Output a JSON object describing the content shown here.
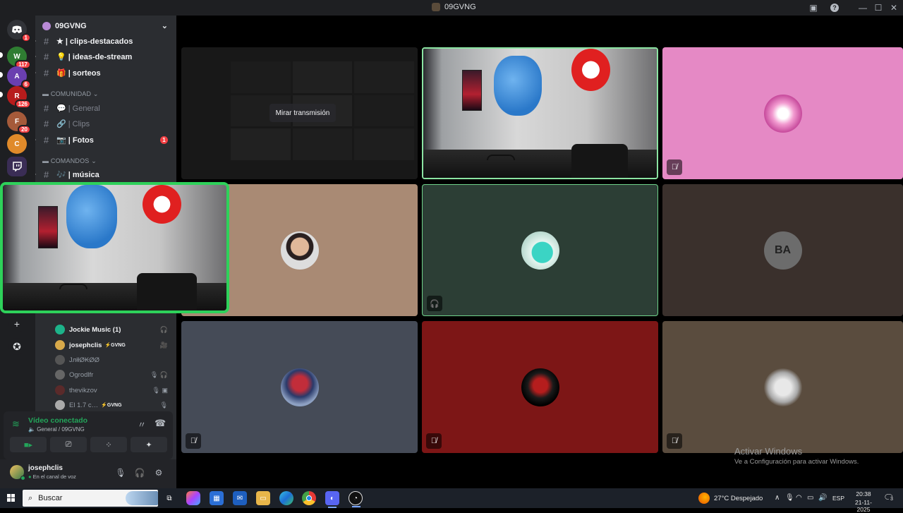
{
  "titlebar": {
    "title": "09GVNG"
  },
  "guilds": {
    "discord_badge": "1",
    "items": [
      {
        "name": "server-weed",
        "badge": "117",
        "color": "#2f7d32"
      },
      {
        "name": "server-anime-girl",
        "badge": "6",
        "color": "#6a3fb0"
      },
      {
        "name": "server-red-logo",
        "badge": "126",
        "color": "#b71c1c"
      },
      {
        "name": "server-face",
        "badge": "20",
        "color": "#a55a3a"
      },
      {
        "name": "server-cartoon",
        "badge": "",
        "color": "#e08a2a"
      },
      {
        "name": "server-twitch",
        "badge": "",
        "color": "#2b2d31"
      }
    ]
  },
  "server": {
    "name": "09GVNG"
  },
  "channels": [
    {
      "label": "★ | clips-destacados",
      "muted": false
    },
    {
      "label": "💡 | ideas-de-stream",
      "muted": false
    },
    {
      "label": "🎁 | sorteos",
      "muted": false
    }
  ],
  "category_comunidad": "COMUNIDAD",
  "comunidad_channels": [
    {
      "label": "💬 | General"
    },
    {
      "label": "🔗 | Clips"
    },
    {
      "label": "📷 | Fotos",
      "badge": "1"
    }
  ],
  "category_comandos": "COMANDOS",
  "comandos_channels": [
    {
      "label": "🎶 | música"
    }
  ],
  "voice_users": [
    {
      "name": "Jockie Music (1)",
      "bright": true,
      "tag": "",
      "icons": "🎧",
      "color": "#1db38a"
    },
    {
      "name": "josephclis",
      "bright": true,
      "tag": "⚡GVNG",
      "icons": "🎥",
      "color": "#d8a94a"
    },
    {
      "name": "JлłłØ₭ØØ",
      "bright": false,
      "tag": "",
      "icons": "",
      "color": "#555"
    },
    {
      "name": "Ogrodlfr",
      "bright": false,
      "tag": "",
      "icons": "🎙 🎧",
      "color": "#666"
    },
    {
      "name": "thevikzov",
      "bright": false,
      "tag": "",
      "icons": "🎙 ▣",
      "color": "#5a2a2a"
    },
    {
      "name": "El 1.7 c⁠…",
      "bright": false,
      "tag": "⚡GVNG",
      "icons": "🎙",
      "color": "#aaa"
    }
  ],
  "voice_panel": {
    "title": "Vídeo conectado",
    "subtitle": "General / 09GVNG"
  },
  "user": {
    "name": "josephclis",
    "status": "En el canal de voz"
  },
  "stage": {
    "watch_label": "Mirar transmisión"
  },
  "tiles": [
    {
      "name": "tile-cam-2",
      "color": "#2a2a2a"
    },
    {
      "name": "tile-pink",
      "color": "#e589c5"
    },
    {
      "name": "tile-tan",
      "color": "#a98a74"
    },
    {
      "name": "tile-teal",
      "color": "#2c3e35"
    },
    {
      "name": "tile-dark",
      "color": "#3a302c"
    },
    {
      "name": "tile-slate",
      "color": "#454b57"
    },
    {
      "name": "tile-red",
      "color": "#7d1616"
    },
    {
      "name": "tile-olive",
      "color": "#5a4c3e"
    }
  ],
  "activate": {
    "line1": "Activar Windows",
    "line2": "Ve a Configuración para activar Windows."
  },
  "taskbar": {
    "search_placeholder": "Buscar",
    "weather": "27°C  Despejado",
    "lang": "ESP",
    "time": "20:38",
    "date": "21-11-2025",
    "notif_count": "3"
  }
}
